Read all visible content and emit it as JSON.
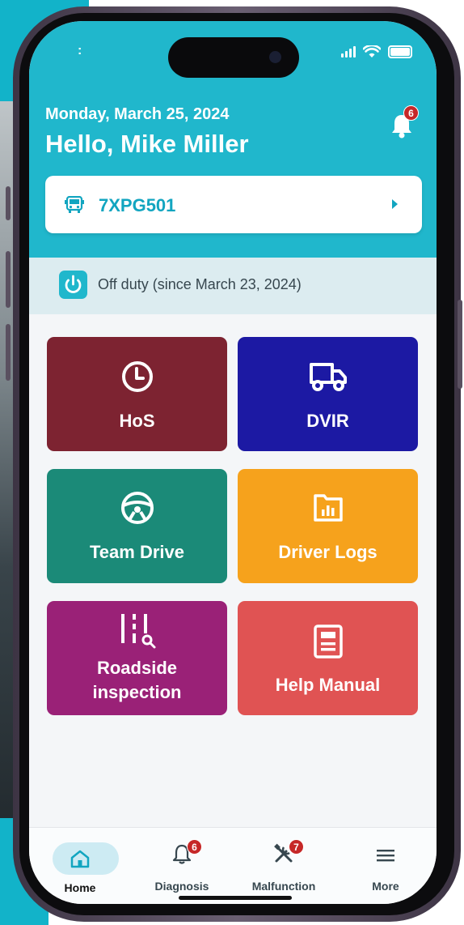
{
  "status_bar": {
    "dots": ":"
  },
  "header": {
    "date": "Monday, March 25, 2024",
    "greeting": "Hello, Mike Miller",
    "notification_count": "6"
  },
  "vehicle": {
    "id": "7XPG501"
  },
  "duty": {
    "status": "Off duty (since March 23, 2024)"
  },
  "tiles": [
    {
      "label": "HoS",
      "icon": "clock-icon",
      "color": "#7d2331"
    },
    {
      "label": "DVIR",
      "icon": "truck-icon",
      "color": "#1c19a3"
    },
    {
      "label": "Team Drive",
      "icon": "steering-wheel-icon",
      "color": "#1b8a78"
    },
    {
      "label": "Driver Logs",
      "icon": "folder-chart-icon",
      "color": "#f6a21c"
    },
    {
      "label_line1": "Roadside",
      "label_line2": "inspection",
      "icon": "roadside-inspection-icon",
      "color": "#9a2177"
    },
    {
      "label": "Help Manual",
      "icon": "document-icon",
      "color": "#e05353"
    }
  ],
  "nav": [
    {
      "label": "Home",
      "icon": "home-icon"
    },
    {
      "label": "Diagnosis",
      "icon": "bell-icon",
      "badge": "6"
    },
    {
      "label": "Malfunction",
      "icon": "tools-icon",
      "badge": "7"
    },
    {
      "label": "More",
      "icon": "menu-icon"
    }
  ]
}
